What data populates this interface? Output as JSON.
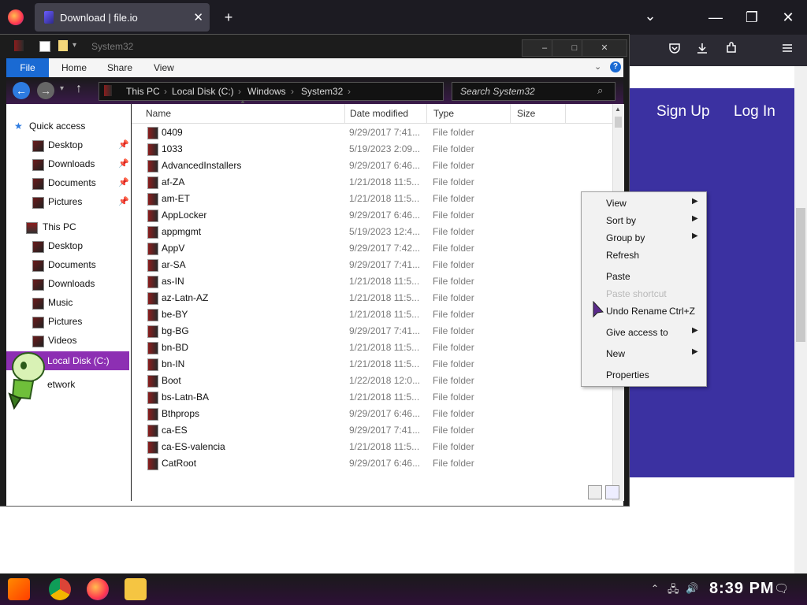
{
  "browser": {
    "tab_title": "Download | file.io",
    "new_tab_glyph": "+",
    "tab_close_glyph": "✕",
    "dropdown_glyph": "⌄",
    "minimize_glyph": "—",
    "restore_glyph": "❐",
    "close_glyph": "✕",
    "toolbar_icons": [
      "pocket-icon",
      "download-icon",
      "extensions-icon",
      "menu-icon"
    ]
  },
  "website": {
    "sign_up": "Sign Up",
    "log_in": "Log In",
    "accent_color": "#3b31a1"
  },
  "explorer": {
    "window_title": "System32",
    "ribbon_tabs": [
      "File",
      "Home",
      "Share",
      "View"
    ],
    "breadcrumb": [
      "This PC",
      "Local Disk (C:)",
      "Windows",
      "System32"
    ],
    "search_placeholder": "Search System32",
    "columns": [
      "Name",
      "Date modified",
      "Type",
      "Size"
    ],
    "nav": {
      "quick_access": "Quick access",
      "quick_items": [
        "Desktop",
        "Downloads",
        "Documents",
        "Pictures"
      ],
      "this_pc": "This PC",
      "pc_items": [
        "Desktop",
        "Documents",
        "Downloads",
        "Music",
        "Pictures",
        "Videos"
      ],
      "selected": "Local Disk (C:)",
      "network": "etwork"
    },
    "rows": [
      {
        "name": "0409",
        "date": "9/29/2017 7:41...",
        "type": "File folder"
      },
      {
        "name": "1033",
        "date": "5/19/2023 2:09...",
        "type": "File folder"
      },
      {
        "name": "AdvancedInstallers",
        "date": "9/29/2017 6:46...",
        "type": "File folder"
      },
      {
        "name": "af-ZA",
        "date": "1/21/2018 11:5...",
        "type": "File folder"
      },
      {
        "name": "am-ET",
        "date": "1/21/2018 11:5...",
        "type": "File folder"
      },
      {
        "name": "AppLocker",
        "date": "9/29/2017 6:46...",
        "type": "File folder"
      },
      {
        "name": "appmgmt",
        "date": "5/19/2023 12:4...",
        "type": "File folder"
      },
      {
        "name": "AppV",
        "date": "9/29/2017 7:42...",
        "type": "File folder"
      },
      {
        "name": "ar-SA",
        "date": "9/29/2017 7:41...",
        "type": "File folder"
      },
      {
        "name": "as-IN",
        "date": "1/21/2018 11:5...",
        "type": "File folder"
      },
      {
        "name": "az-Latn-AZ",
        "date": "1/21/2018 11:5...",
        "type": "File folder"
      },
      {
        "name": "be-BY",
        "date": "1/21/2018 11:5...",
        "type": "File folder"
      },
      {
        "name": "bg-BG",
        "date": "9/29/2017 7:41...",
        "type": "File folder"
      },
      {
        "name": "bn-BD",
        "date": "1/21/2018 11:5...",
        "type": "File folder"
      },
      {
        "name": "bn-IN",
        "date": "1/21/2018 11:5...",
        "type": "File folder"
      },
      {
        "name": "Boot",
        "date": "1/22/2018 12:0...",
        "type": "File folder"
      },
      {
        "name": "bs-Latn-BA",
        "date": "1/21/2018 11:5...",
        "type": "File folder"
      },
      {
        "name": "Bthprops",
        "date": "9/29/2017 6:46...",
        "type": "File folder"
      },
      {
        "name": "ca-ES",
        "date": "9/29/2017 7:41...",
        "type": "File folder"
      },
      {
        "name": "ca-ES-valencia",
        "date": "1/21/2018 11:5...",
        "type": "File folder"
      },
      {
        "name": "CatRoot",
        "date": "9/29/2017 6:46...",
        "type": "File folder"
      }
    ]
  },
  "context_menu": {
    "items": [
      {
        "label": "View",
        "submenu": true,
        "disabled": false
      },
      {
        "label": "Sort by",
        "submenu": true,
        "disabled": false
      },
      {
        "label": "Group by",
        "submenu": true,
        "disabled": false
      },
      {
        "label": "Refresh",
        "submenu": false,
        "disabled": false
      },
      {
        "label": "Paste",
        "submenu": false,
        "disabled": false
      },
      {
        "label": "Paste shortcut",
        "submenu": false,
        "disabled": true
      },
      {
        "label": "Undo Rename",
        "shortcut": "Ctrl+Z",
        "submenu": false,
        "disabled": false
      },
      {
        "label": "Give access to",
        "submenu": true,
        "disabled": false
      },
      {
        "label": "New",
        "submenu": true,
        "disabled": false
      },
      {
        "label": "Properties",
        "submenu": false,
        "disabled": false
      }
    ]
  },
  "taskbar": {
    "clock": "8:39 PM",
    "apps": [
      "start-button",
      "chrome-icon",
      "firefox-icon",
      "file-explorer-icon"
    ]
  }
}
